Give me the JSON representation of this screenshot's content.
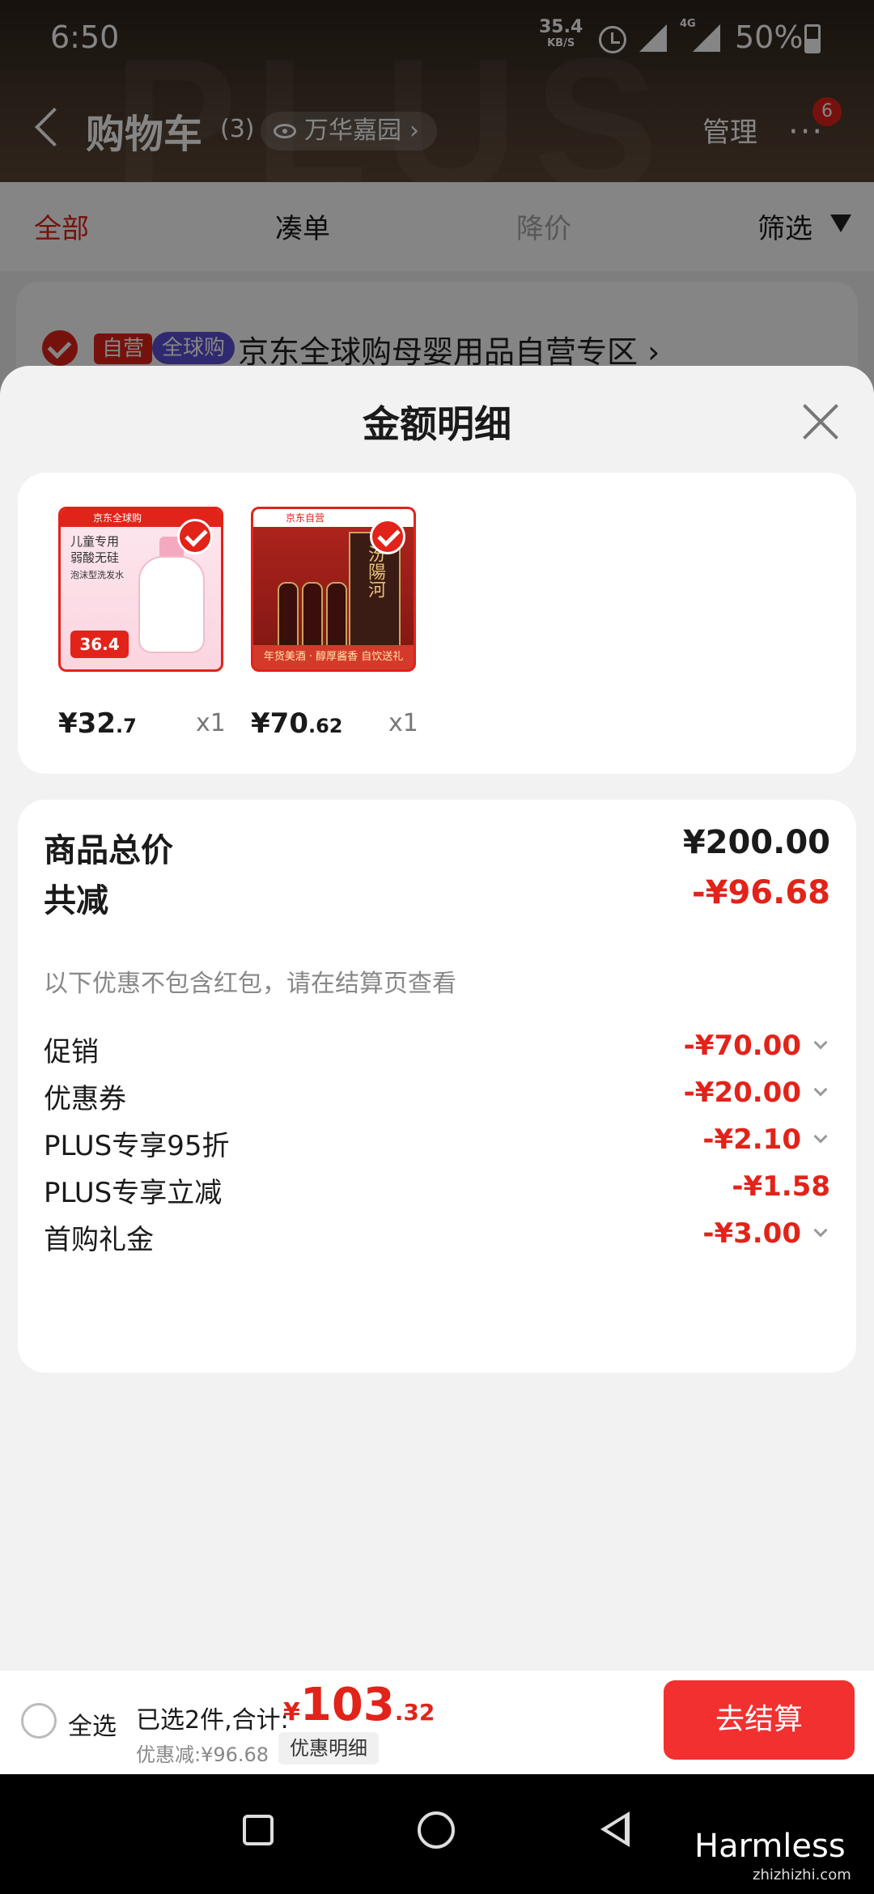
{
  "status_bar": {
    "time": "6:50",
    "speed_value": "35.4",
    "speed_unit": "KB/S",
    "network": "4G",
    "battery": "50%"
  },
  "header": {
    "title": "购物车",
    "count": "(3)",
    "location": "万华嘉园",
    "location_arrow": "›",
    "manage": "管理",
    "more": "···",
    "badge": "6",
    "bg_text": "PLUS"
  },
  "filters": {
    "all": "全部",
    "bundle": "凑单",
    "price_drop": "降价",
    "filter": "筛选"
  },
  "store": {
    "tag_self": "自营",
    "tag_global": "全球购",
    "name": "京东全球购母婴用品自营专区",
    "arrow": "›"
  },
  "sheet": {
    "title": "金额明细",
    "items": [
      {
        "price_int": "¥32",
        "price_dec": ".7",
        "qty": "x1",
        "art": {
          "header": "京东全球购",
          "line1": "儿童专用",
          "line2": "弱酸无硅",
          "line3": "泡沫型洗发水",
          "price_tag": "36.4"
        }
      },
      {
        "price_int": "¥70",
        "price_dec": ".62",
        "qty": "x1",
        "art": {
          "header": "京东自营",
          "brand": "汾陽河",
          "banner": "年货美酒 · 醇厚酱香 自饮送礼"
        }
      }
    ],
    "summary": {
      "total_label": "商品总价",
      "total_value": "¥200.00",
      "discount_label": "共减",
      "discount_value": "-¥96.68",
      "note": "以下优惠不包含红包，请在结算页查看",
      "lines": [
        {
          "label": "促销",
          "value": "-¥70.00"
        },
        {
          "label": "优惠券",
          "value": "-¥20.00"
        },
        {
          "label": "PLUS专享95折",
          "value": "-¥2.10"
        },
        {
          "label": "PLUS专享立减",
          "value": "-¥1.58"
        },
        {
          "label": "首购礼金",
          "value": "-¥3.00"
        }
      ]
    }
  },
  "bottom_bar": {
    "select_all": "全选",
    "selected": "已选2件,合计:",
    "currency": "¥",
    "total_int": "103",
    "total_dec": ".32",
    "saved": "优惠减:¥96.68",
    "detail_button": "优惠明细",
    "checkout": "去结算"
  },
  "watermark": {
    "main": "Harmless",
    "sub": "zhizhizhi.com"
  },
  "colors": {
    "accent": "#e2231a",
    "checkout": "#f23030",
    "header_bg": "#3b2e24"
  }
}
